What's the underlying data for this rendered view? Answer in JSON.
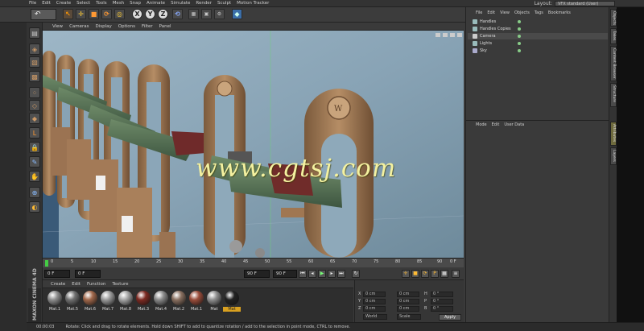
{
  "menubar": {
    "items": [
      "File",
      "Edit",
      "Create",
      "Select",
      "Tools",
      "Mesh",
      "Snap",
      "Animate",
      "Simulate",
      "Render",
      "Sculpt",
      "Motion Tracker"
    ],
    "layout_label": "Layout:",
    "layout_value": "VFX standard (User)"
  },
  "toolbar": {
    "axis_x": "X",
    "axis_y": "Y",
    "axis_z": "Z"
  },
  "viewport": {
    "menu": [
      "View",
      "Cameras",
      "Display",
      "Options",
      "Filter",
      "Panel"
    ],
    "watermark": "www.cgtsj.com",
    "overlay_colors": {
      "wall": "#8ea9ba",
      "wood": "#a57c56",
      "green_handle": "#4e6a4c",
      "watermark": "#f4f1a0"
    }
  },
  "timeline": {
    "ticks": [
      "0",
      "5",
      "10",
      "15",
      "20",
      "25",
      "30",
      "35",
      "40",
      "45",
      "50",
      "55",
      "60",
      "65",
      "70",
      "75",
      "80",
      "85",
      "90"
    ],
    "end_label": "0 F"
  },
  "playback": {
    "start_frame": "0 F",
    "current_frame": "0 F",
    "end_frame": "90 F",
    "end_frame2": "90 F"
  },
  "materials": {
    "menu": [
      "Create",
      "Edit",
      "Function",
      "Texture"
    ],
    "items": [
      {
        "label": "Mat.1",
        "color": "#8d8d8d"
      },
      {
        "label": "Mat.5",
        "color": "#707070"
      },
      {
        "label": "Mat.6",
        "color": "#a0674a"
      },
      {
        "label": "Mat.7",
        "color": "#9a9a9a"
      },
      {
        "label": "Mat.8",
        "color": "#a5a5a5"
      },
      {
        "label": "Mat.3",
        "color": "#7d2a22"
      },
      {
        "label": "Mat.4",
        "color": "#8a8a8a"
      },
      {
        "label": "Mat.2",
        "color": "#8a7060"
      },
      {
        "label": "Mat.1",
        "color": "#9a4c3a"
      },
      {
        "label": "Mat",
        "color": "#8e8e8e"
      },
      {
        "label": "Mat",
        "color": "#222222"
      }
    ],
    "brand": "MAXON CINEMA 4D"
  },
  "coords": {
    "x_label": "X",
    "y_label": "Y",
    "z_label": "Z",
    "x_val": "0 cm",
    "y_val": "0 cm",
    "z_val": "0 cm",
    "x_val2": "0 cm",
    "y_val2": "0 cm",
    "z_val2": "0 cm",
    "h_label": "H",
    "p_label": "P",
    "b_label": "B",
    "h_val": "0 °",
    "p_val": "0 °",
    "b_val": "0 °",
    "mode1": "World",
    "mode2": "Scale",
    "apply": "Apply"
  },
  "objects": {
    "menu": [
      "File",
      "Edit",
      "View",
      "Objects",
      "Tags",
      "Bookmarks"
    ],
    "rows": [
      {
        "label": "Handles"
      },
      {
        "label": "Handles Copies"
      },
      {
        "label": "Camera"
      },
      {
        "label": "Lights"
      },
      {
        "label": "Sky"
      }
    ]
  },
  "attributes": {
    "menu": [
      "Mode",
      "Edit",
      "User Data"
    ]
  },
  "right_tabs": [
    "Objects",
    "Takes",
    "Content Browser",
    "Structure",
    "Attributes",
    "Layers"
  ],
  "status": {
    "time": "00:00:03",
    "message": "Rotate: Click and drag to rotate elements. Hold down SHIFT to add to quantize rotation / add to the selection in point mode, CTRL to remove."
  }
}
